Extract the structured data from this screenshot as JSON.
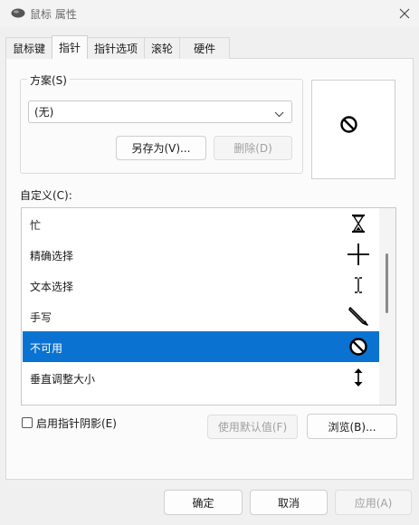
{
  "window": {
    "title": "鼠标 属性"
  },
  "tabs": [
    {
      "label": "鼠标键",
      "active": false
    },
    {
      "label": "指针",
      "active": true
    },
    {
      "label": "指针选项",
      "active": false
    },
    {
      "label": "滚轮",
      "active": false
    },
    {
      "label": "硬件",
      "active": false
    }
  ],
  "scheme": {
    "legend": "方案(S)",
    "selected": "(无)",
    "save_as_label": "另存为(V)...",
    "delete_label": "删除(D)"
  },
  "preview": {
    "icon": "unavailable-cursor-icon"
  },
  "customize": {
    "label": "自定义(C):",
    "items": [
      {
        "label": "忙",
        "icon": "hourglass-icon",
        "selected": false
      },
      {
        "label": "精确选择",
        "icon": "crosshair-icon",
        "selected": false
      },
      {
        "label": "文本选择",
        "icon": "ibeam-icon",
        "selected": false
      },
      {
        "label": "手写",
        "icon": "pen-icon",
        "selected": false
      },
      {
        "label": "不可用",
        "icon": "unavailable-cursor-icon",
        "selected": true
      },
      {
        "label": "垂直调整大小",
        "icon": "vertical-resize-icon",
        "selected": false
      }
    ]
  },
  "shadow_checkbox": {
    "label": "启用指针阴影(E)",
    "checked": false
  },
  "use_default_label": "使用默认值(F)",
  "browse_label": "浏览(B)...",
  "footer": {
    "ok_label": "确定",
    "cancel_label": "取消",
    "apply_label": "应用(A)"
  },
  "colors": {
    "selection": "#0a73d2",
    "background": "#f0f0f0",
    "panel": "#fbfbfb"
  }
}
